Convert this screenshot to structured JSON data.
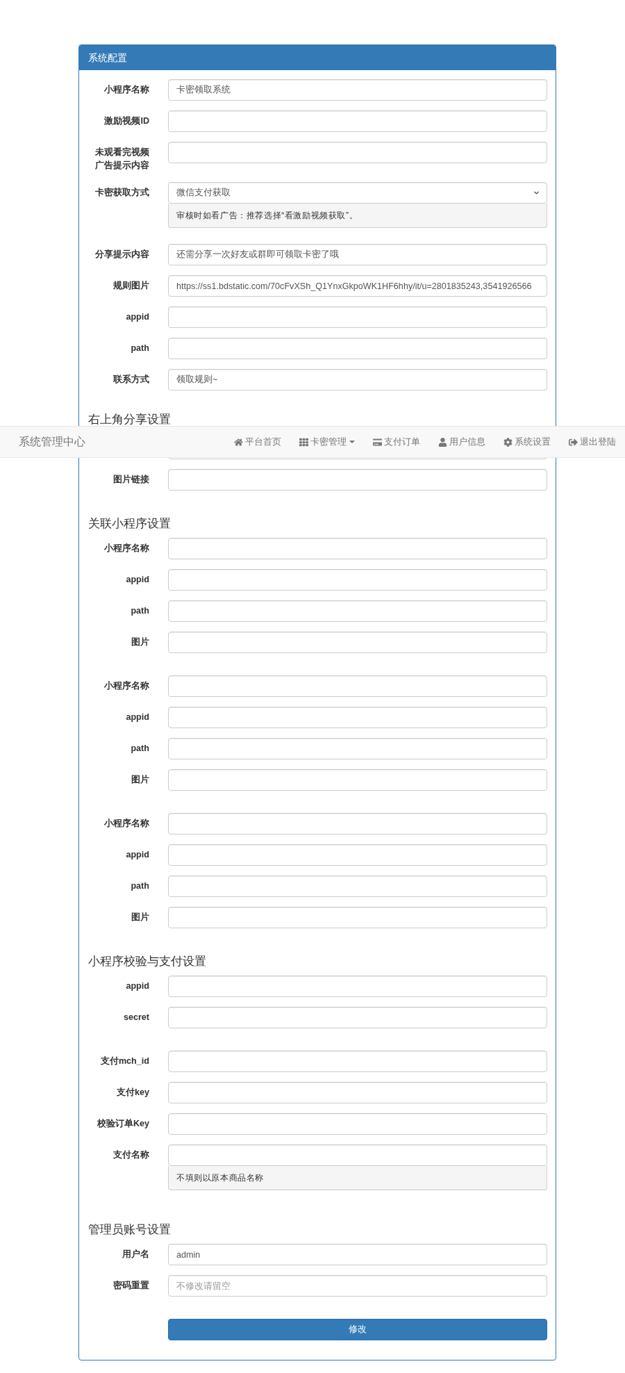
{
  "navbar": {
    "brand": "系统管理中心",
    "items": [
      {
        "label": "平台首页",
        "dropdown": false
      },
      {
        "label": "卡密管理",
        "dropdown": true
      },
      {
        "label": "支付订单",
        "dropdown": false
      },
      {
        "label": "用户信息",
        "dropdown": false
      },
      {
        "label": "系统设置",
        "dropdown": false
      },
      {
        "label": "退出登陆",
        "dropdown": false
      }
    ]
  },
  "panel": {
    "title": "系统配置",
    "sections": [
      {
        "groups": [
          {
            "fields": [
              {
                "label": "小程序名称",
                "kind": "input",
                "value": "卡密领取系统"
              },
              {
                "label": "激励视频ID",
                "kind": "input"
              },
              {
                "label": "未观看完视频广告提示内容",
                "kind": "input"
              },
              {
                "label": "卡密获取方式",
                "kind": "select",
                "value": "微信支付获取",
                "help": "审核时如看广告：推荐选择“看激励视频获取”。"
              },
              {
                "label": "分享提示内容",
                "kind": "input",
                "value": "还需分享一次好友或群即可领取卡密了哦"
              },
              {
                "label": "规则图片",
                "kind": "input",
                "value": "https://ss1.bdstatic.com/70cFvXSh_Q1YnxGkpoWK1HF6hhy/it/u=2801835243,3541926566"
              },
              {
                "label": "appid",
                "kind": "input"
              },
              {
                "label": "path",
                "kind": "input"
              },
              {
                "label": "联系方式",
                "kind": "input",
                "value": "领取规则~"
              }
            ]
          }
        ]
      },
      {
        "heading": "右上角分享设置",
        "groups": [
          {
            "fields": [
              {
                "kind": "input"
              },
              {
                "label": "图片链接",
                "kind": "input"
              }
            ]
          }
        ]
      },
      {
        "heading": "关联小程序设置",
        "groups": [
          {
            "fields": [
              {
                "label": "小程序名称",
                "kind": "input"
              },
              {
                "label": "appid",
                "kind": "input"
              },
              {
                "label": "path",
                "kind": "input"
              },
              {
                "label": "图片",
                "kind": "input"
              }
            ]
          },
          {
            "fields": [
              {
                "label": "小程序名称",
                "kind": "input"
              },
              {
                "label": "appid",
                "kind": "input"
              },
              {
                "label": "path",
                "kind": "input"
              },
              {
                "label": "图片",
                "kind": "input"
              }
            ]
          },
          {
            "fields": [
              {
                "label": "小程序名称",
                "kind": "input"
              },
              {
                "label": "appid",
                "kind": "input"
              },
              {
                "label": "path",
                "kind": "input"
              },
              {
                "label": "图片",
                "kind": "input"
              }
            ]
          }
        ]
      },
      {
        "heading": "小程序校验与支付设置",
        "groups": [
          {
            "fields": [
              {
                "label": "appid",
                "kind": "input"
              },
              {
                "label": "secret",
                "kind": "input"
              }
            ]
          },
          {
            "fields": [
              {
                "label": "支付mch_id",
                "kind": "input"
              },
              {
                "label": "支付key",
                "kind": "input"
              },
              {
                "label": "校验订单Key",
                "kind": "input"
              },
              {
                "label": "支付名称",
                "kind": "input",
                "help": "不填则以原本商品名称"
              }
            ]
          }
        ]
      },
      {
        "heading": "管理员账号设置",
        "groups": [
          {
            "fields": [
              {
                "label": "用户名",
                "kind": "input",
                "value": "admin"
              },
              {
                "label": "密码重置",
                "kind": "input",
                "placeholder": "不修改请留空"
              }
            ]
          }
        ]
      }
    ],
    "submit_button": "修改"
  }
}
